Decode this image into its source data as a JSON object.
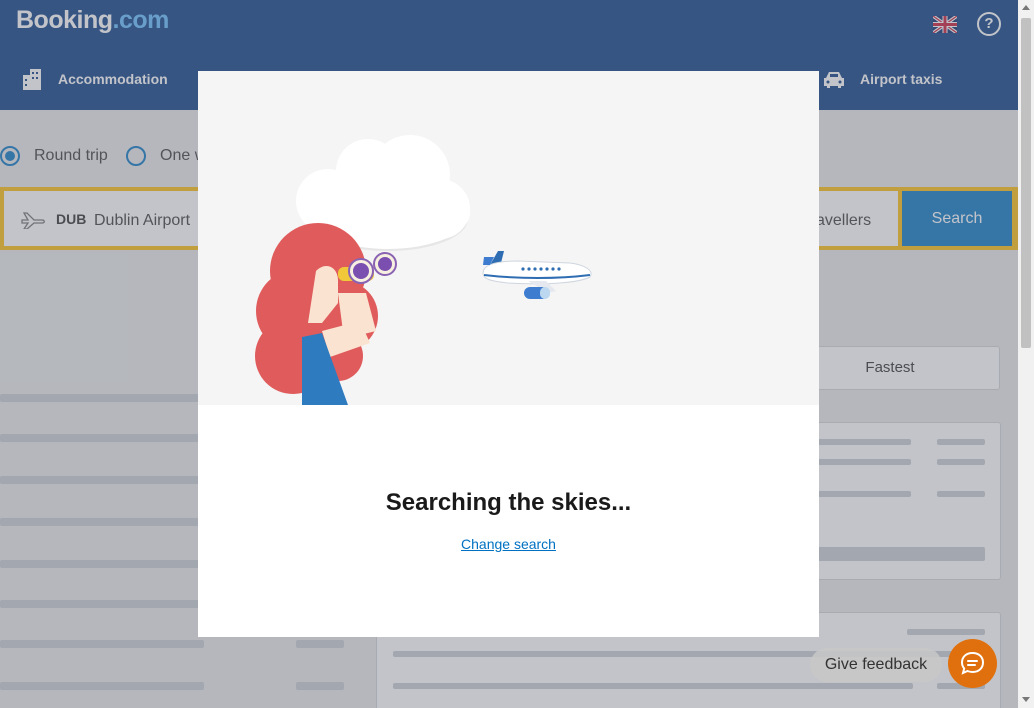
{
  "header": {
    "logo_main": "Booking",
    "logo_suffix": ".com",
    "nav": [
      {
        "label": "Accommodation",
        "icon": "building-icon"
      },
      {
        "label": "Airport taxis",
        "icon": "taxi-icon"
      }
    ]
  },
  "trip_type": {
    "options": [
      {
        "label": "Round trip",
        "selected": true
      },
      {
        "label": "One w",
        "selected": false
      }
    ]
  },
  "search": {
    "origin_code": "DUB",
    "origin_name": "Dublin Airport",
    "travellers_label": "avellers",
    "button_label": "Search"
  },
  "sort": {
    "fastest_label": "Fastest"
  },
  "modal": {
    "title": "Searching the skies...",
    "link_label": "Change search"
  },
  "feedback": {
    "label": "Give feedback"
  },
  "colors": {
    "brand": "#003580",
    "accent": "#0071c2",
    "search_bar": "#febb02",
    "chat": "#e0700d"
  }
}
